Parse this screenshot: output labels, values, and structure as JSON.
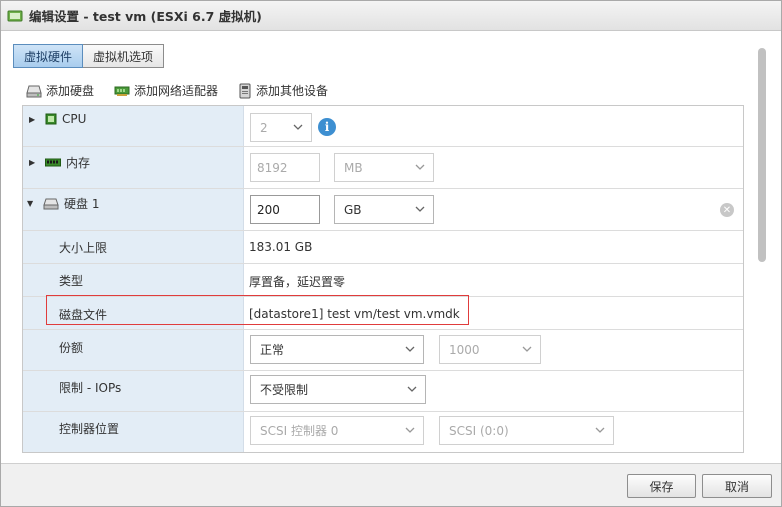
{
  "window": {
    "title": "编辑设置 - test vm (ESXi 6.7 虚拟机)"
  },
  "tabs": [
    {
      "label": "虚拟硬件",
      "active": true
    },
    {
      "label": "虚拟机选项",
      "active": false
    }
  ],
  "toolbar": {
    "add_disk": "添加硬盘",
    "add_network": "添加网络适配器",
    "add_other": "添加其他设备"
  },
  "cpu": {
    "label": "CPU",
    "value": "2"
  },
  "memory": {
    "label": "内存",
    "value": "8192",
    "unit": "MB"
  },
  "disk": {
    "label": "硬盘 1",
    "size": "200",
    "unit": "GB",
    "max_size_label": "大小上限",
    "max_size_value": "183.01 GB",
    "type_label": "类型",
    "type_value": "厚置备，延迟置零",
    "file_label": "磁盘文件",
    "file_value": "[datastore1] test vm/test vm.vmdk",
    "shares_label": "份额",
    "shares_value": "正常",
    "shares_num": "1000",
    "limit_label": "限制 - IOPs",
    "limit_value": "不受限制",
    "controller_label": "控制器位置",
    "controller_value": "SCSI 控制器 0",
    "controller_slot": "SCSI (0:0)"
  },
  "footer": {
    "save": "保存",
    "cancel": "取消"
  },
  "colors": {
    "accent": "#3d8fd1",
    "highlight": "#e03c3c",
    "label_bg": "#e3edf6"
  }
}
